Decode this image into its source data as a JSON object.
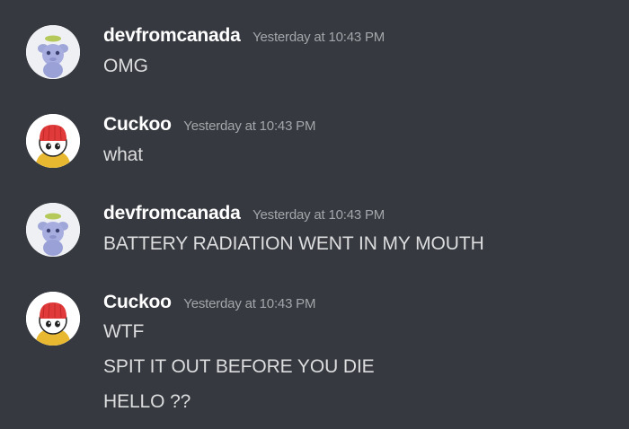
{
  "messages": [
    {
      "author": "devfromcanada",
      "timestamp": "Yesterday at 10:43 PM",
      "avatar_icon": "wumpus-avatar-icon",
      "lines": [
        "OMG"
      ]
    },
    {
      "author": "Cuckoo",
      "timestamp": "Yesterday at 10:43 PM",
      "avatar_icon": "cuckoo-avatar-icon",
      "lines": [
        "what"
      ]
    },
    {
      "author": "devfromcanada",
      "timestamp": "Yesterday at 10:43 PM",
      "avatar_icon": "wumpus-avatar-icon",
      "lines": [
        "BATTERY RADIATION WENT IN MY MOUTH"
      ]
    },
    {
      "author": "Cuckoo",
      "timestamp": "Yesterday at 10:43 PM",
      "avatar_icon": "cuckoo-avatar-icon",
      "lines": [
        "WTF",
        "SPIT IT OUT BEFORE YOU DIE",
        "HELLO ??"
      ]
    }
  ],
  "colors": {
    "background": "#36393f",
    "username": "#ffffff",
    "timestamp": "#a3a6aa",
    "message_text": "#dcddde"
  }
}
